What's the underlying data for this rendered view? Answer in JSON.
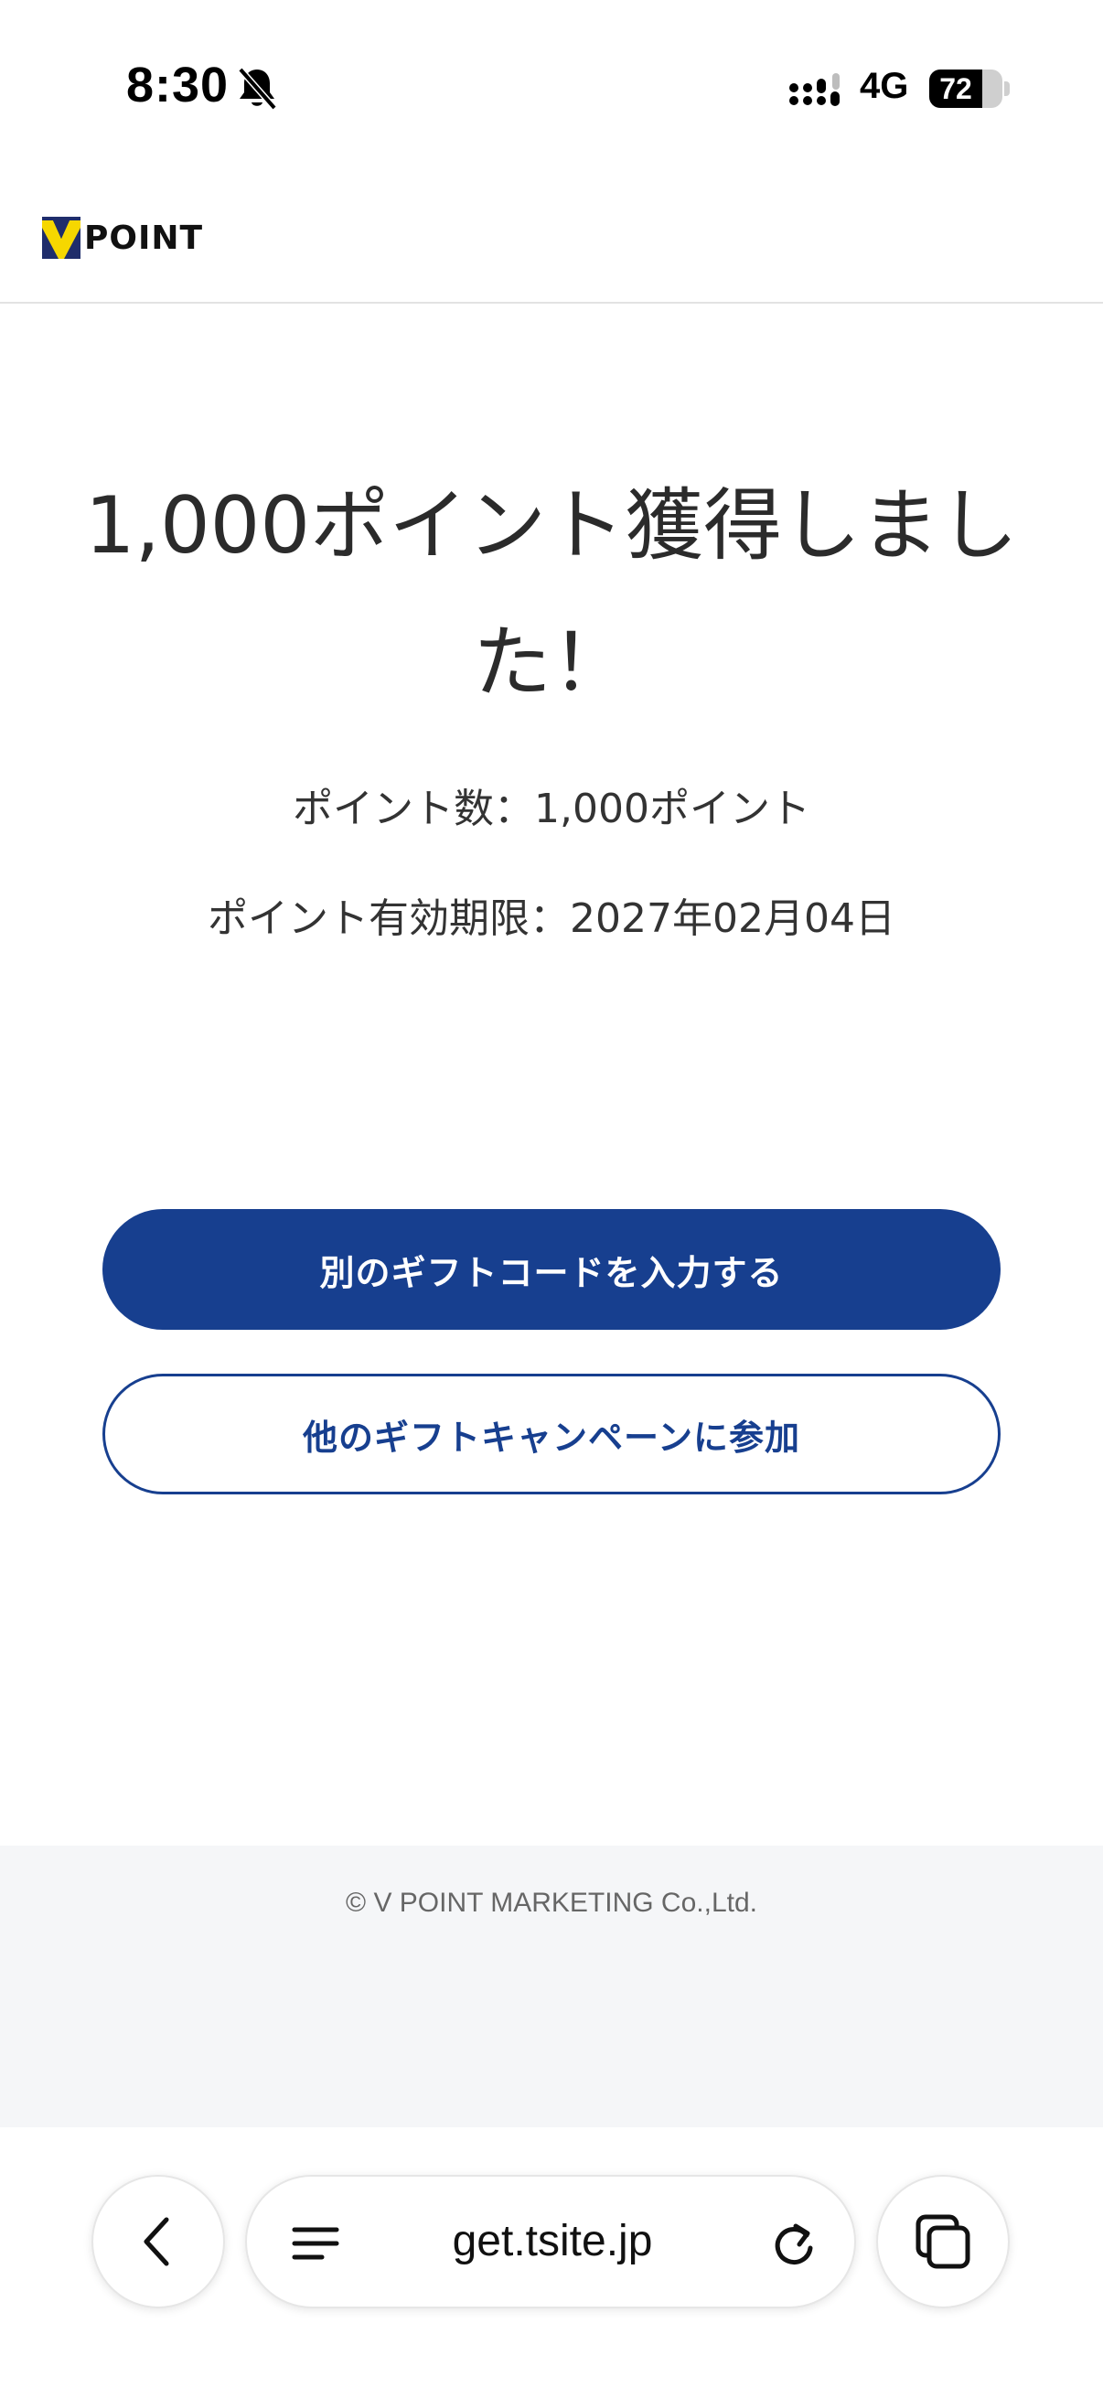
{
  "status_bar": {
    "time": "8:30",
    "network": "4G",
    "battery": "72",
    "battery_level": 0.72,
    "icons": [
      "bell-off-icon",
      "signal-icon",
      "battery-icon"
    ]
  },
  "header": {
    "logo_text": "POINT",
    "logo_colors": {
      "navy": "#1f2d6b",
      "yellow": "#f6d700"
    }
  },
  "main": {
    "headline": "1,000ポイント獲得しました！",
    "points_line": "ポイント数：1,000ポイント",
    "expiry_line": "ポイント有効期限：2027年02月04日",
    "primary_button": "別のギフトコードを入力する",
    "secondary_button": "他のギフトキャンペーンに参加"
  },
  "footer": {
    "copyright": "© V POINT MARKETING Co.,Ltd."
  },
  "browser": {
    "url": "get.tsite.jp",
    "icons": [
      "back-chevron-icon",
      "menu-icon",
      "reload-icon",
      "tabs-icon"
    ]
  },
  "colors": {
    "accent": "#173f8f",
    "footer_bg": "#f5f6f8",
    "text": "#2b2b2b"
  }
}
